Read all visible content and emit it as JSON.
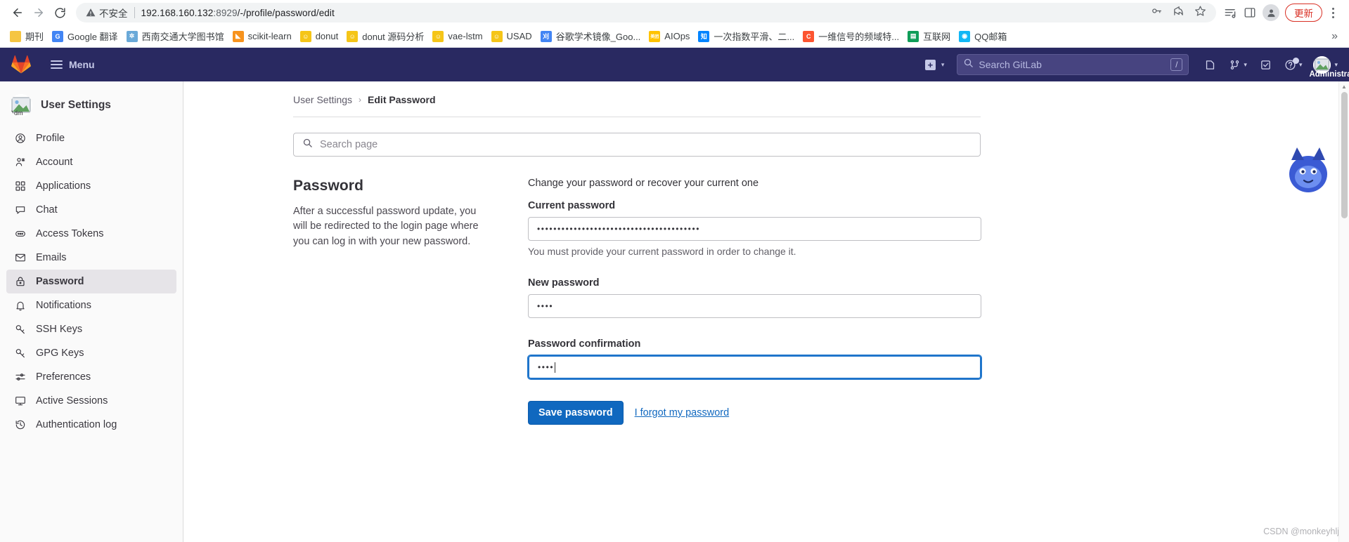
{
  "browser": {
    "nav": {
      "back": "back-arrow",
      "forward": "forward-arrow",
      "reload": "reload"
    },
    "omnibox": {
      "security_label": "不安全",
      "url_host": "192.168.160.132",
      "url_port": ":8929",
      "url_path": "/-/profile/password/edit"
    },
    "toolbar_icons": [
      "key-icon",
      "share-icon",
      "star-icon",
      "reading-list-icon",
      "side-panel-icon"
    ],
    "profile": "profile-avatar",
    "update_label": "更新",
    "menu": "kebab-menu"
  },
  "bookmarks": {
    "items": [
      {
        "label": "期刊",
        "icon": "folder-icon",
        "color": "#f5c542",
        "glyph": ""
      },
      {
        "label": "Google 翻译",
        "icon": "google-translate",
        "color": "#4285f4",
        "glyph": "G"
      },
      {
        "label": "西南交通大学图书馆",
        "icon": "library-icon",
        "color": "#6aa9d8",
        "glyph": "✲"
      },
      {
        "label": "scikit-learn",
        "icon": "scikit-learn-icon",
        "color": "#f7931e",
        "glyph": "◣"
      },
      {
        "label": "donut",
        "icon": "emoji-icon",
        "color": "#f5c518",
        "glyph": "☺"
      },
      {
        "label": "donut 源码分析",
        "icon": "emoji-icon",
        "color": "#f5c518",
        "glyph": "☺"
      },
      {
        "label": "vae-lstm",
        "icon": "emoji-icon",
        "color": "#f5c518",
        "glyph": "☺"
      },
      {
        "label": "USAD",
        "icon": "emoji-icon",
        "color": "#f5c518",
        "glyph": "☺"
      },
      {
        "label": "谷歌学术镜像_Goo...",
        "icon": "scholar-icon",
        "color": "#4285f4",
        "glyph": "刈"
      },
      {
        "label": "AIOps",
        "icon": "meituan-icon",
        "color": "#ffc300",
        "glyph": "美团"
      },
      {
        "label": "一次指数平滑、二...",
        "icon": "zhihu-icon",
        "color": "#0084ff",
        "glyph": "知"
      },
      {
        "label": "一维信号的频域特...",
        "icon": "csdn-icon",
        "color": "#fc5531",
        "glyph": "C"
      },
      {
        "label": "互联网",
        "icon": "sheets-icon",
        "color": "#0f9d58",
        "glyph": "▤"
      },
      {
        "label": "QQ邮箱",
        "icon": "qqmail-icon",
        "color": "#12b7f5",
        "glyph": "◉"
      }
    ],
    "overflow": "»"
  },
  "gitlab_nav": {
    "logo": "gitlab-logo",
    "menu_label": "Menu",
    "new_button": "new-dropdown",
    "search_placeholder": "Search GitLab",
    "search_shortcut": "/",
    "icons": [
      "issues-icon",
      "merge-requests-icon",
      "todos-icon",
      "help-icon"
    ],
    "username": "Administrator",
    "accent": "#292961"
  },
  "sidebar": {
    "title": "User Settings",
    "avatar": "user-avatar",
    "items": [
      {
        "label": "Profile",
        "icon": "user-circle-icon",
        "active": false
      },
      {
        "label": "Account",
        "icon": "account-icon",
        "active": false
      },
      {
        "label": "Applications",
        "icon": "applications-icon",
        "active": false
      },
      {
        "label": "Chat",
        "icon": "chat-icon",
        "active": false
      },
      {
        "label": "Access Tokens",
        "icon": "token-icon",
        "active": false
      },
      {
        "label": "Emails",
        "icon": "envelope-icon",
        "active": false
      },
      {
        "label": "Password",
        "icon": "lock-icon",
        "active": true
      },
      {
        "label": "Notifications",
        "icon": "bell-icon",
        "active": false
      },
      {
        "label": "SSH Keys",
        "icon": "key-icon",
        "active": false
      },
      {
        "label": "GPG Keys",
        "icon": "key-icon",
        "active": false
      },
      {
        "label": "Preferences",
        "icon": "preferences-icon",
        "active": false
      },
      {
        "label": "Active Sessions",
        "icon": "monitor-icon",
        "active": false
      },
      {
        "label": "Authentication log",
        "icon": "history-icon",
        "active": false
      }
    ]
  },
  "main": {
    "breadcrumb": {
      "root": "User Settings",
      "separator": "›",
      "current": "Edit Password"
    },
    "page_search_placeholder": "Search page",
    "left": {
      "heading": "Password",
      "description": "After a successful password update, you will be redirected to the login page where you can log in with your new password."
    },
    "form": {
      "lead": "Change your password or recover your current one",
      "current_password": {
        "label": "Current password",
        "value": "••••••••••••••••••••••••••••••••••••••••",
        "helper": "You must provide your current password in order to change it."
      },
      "new_password": {
        "label": "New password",
        "value": "••••"
      },
      "password_confirmation": {
        "label": "Password confirmation",
        "value": "••••",
        "focused": true
      },
      "submit_label": "Save password",
      "forgot_link": "I forgot my password"
    }
  },
  "watermark": "CSDN @monkeyhlj",
  "colors": {
    "gitlab_navy": "#292961",
    "primary_blue": "#1068bf",
    "focus_blue": "#1f75cb",
    "sidebar_bg": "#fafafa",
    "active_item": "#e6e4e8"
  }
}
